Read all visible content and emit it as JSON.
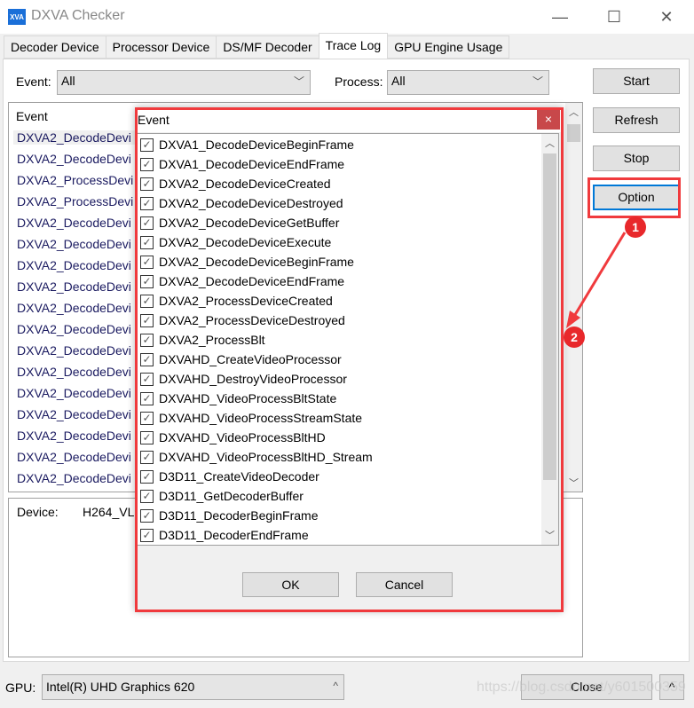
{
  "window": {
    "logo": "XVA",
    "title": "DXVA Checker",
    "minimize": "—",
    "maximize": "☐",
    "close": "✕"
  },
  "tabs": [
    {
      "label": "Decoder Device"
    },
    {
      "label": "Processor Device"
    },
    {
      "label": "DS/MF Decoder"
    },
    {
      "label": "Trace Log",
      "active": true
    },
    {
      "label": "GPU Engine Usage"
    }
  ],
  "filters": {
    "event_label": "Event:",
    "event_value": "All",
    "process_label": "Process:",
    "process_value": "All"
  },
  "buttons": {
    "start": "Start",
    "refresh": "Refresh",
    "stop": "Stop",
    "option": "Option"
  },
  "log": {
    "header": "Event",
    "rows": [
      "DXVA2_DecodeDevi",
      "DXVA2_DecodeDevi",
      "DXVA2_ProcessDevi",
      "DXVA2_ProcessDevi",
      "DXVA2_DecodeDevi",
      "DXVA2_DecodeDevi",
      "DXVA2_DecodeDevi",
      "DXVA2_DecodeDevi",
      "DXVA2_DecodeDevi",
      "DXVA2_DecodeDevi",
      "DXVA2_DecodeDevi",
      "DXVA2_DecodeDevi",
      "DXVA2_DecodeDevi",
      "DXVA2_DecodeDevi",
      "DXVA2_DecodeDevi",
      "DXVA2_DecodeDevi",
      "DXVA2_DecodeDevi"
    ]
  },
  "details": {
    "device_label": "Device:",
    "device_value": "H264_VL"
  },
  "bottom": {
    "gpu_label": "GPU:",
    "gpu_value": "Intel(R) UHD Graphics 620",
    "close": "Close",
    "expand": "^"
  },
  "dialog": {
    "title": "Event",
    "close": "×",
    "ok": "OK",
    "cancel": "Cancel",
    "items": [
      {
        "label": "DXVA1_DecodeDeviceBeginFrame",
        "checked": true
      },
      {
        "label": "DXVA1_DecodeDeviceEndFrame",
        "checked": true
      },
      {
        "label": "DXVA2_DecodeDeviceCreated",
        "checked": true
      },
      {
        "label": "DXVA2_DecodeDeviceDestroyed",
        "checked": true
      },
      {
        "label": "DXVA2_DecodeDeviceGetBuffer",
        "checked": true
      },
      {
        "label": "DXVA2_DecodeDeviceExecute",
        "checked": true
      },
      {
        "label": "DXVA2_DecodeDeviceBeginFrame",
        "checked": true
      },
      {
        "label": "DXVA2_DecodeDeviceEndFrame",
        "checked": true
      },
      {
        "label": "DXVA2_ProcessDeviceCreated",
        "checked": true
      },
      {
        "label": "DXVA2_ProcessDeviceDestroyed",
        "checked": true
      },
      {
        "label": "DXVA2_ProcessBlt",
        "checked": true
      },
      {
        "label": "DXVAHD_CreateVideoProcessor",
        "checked": true
      },
      {
        "label": "DXVAHD_DestroyVideoProcessor",
        "checked": true
      },
      {
        "label": "DXVAHD_VideoProcessBltState",
        "checked": true
      },
      {
        "label": "DXVAHD_VideoProcessStreamState",
        "checked": true
      },
      {
        "label": "DXVAHD_VideoProcessBltHD",
        "checked": true
      },
      {
        "label": "DXVAHD_VideoProcessBltHD_Stream",
        "checked": true
      },
      {
        "label": "D3D11_CreateVideoDecoder",
        "checked": true
      },
      {
        "label": "D3D11_GetDecoderBuffer",
        "checked": true
      },
      {
        "label": "D3D11_DecoderBeginFrame",
        "checked": true
      },
      {
        "label": "D3D11_DecoderEndFrame",
        "checked": true
      }
    ]
  },
  "annotations": {
    "step1": "1",
    "step2": "2",
    "color": "#f03a3d"
  },
  "watermark": "https://blog.csdn.net/y601500359"
}
